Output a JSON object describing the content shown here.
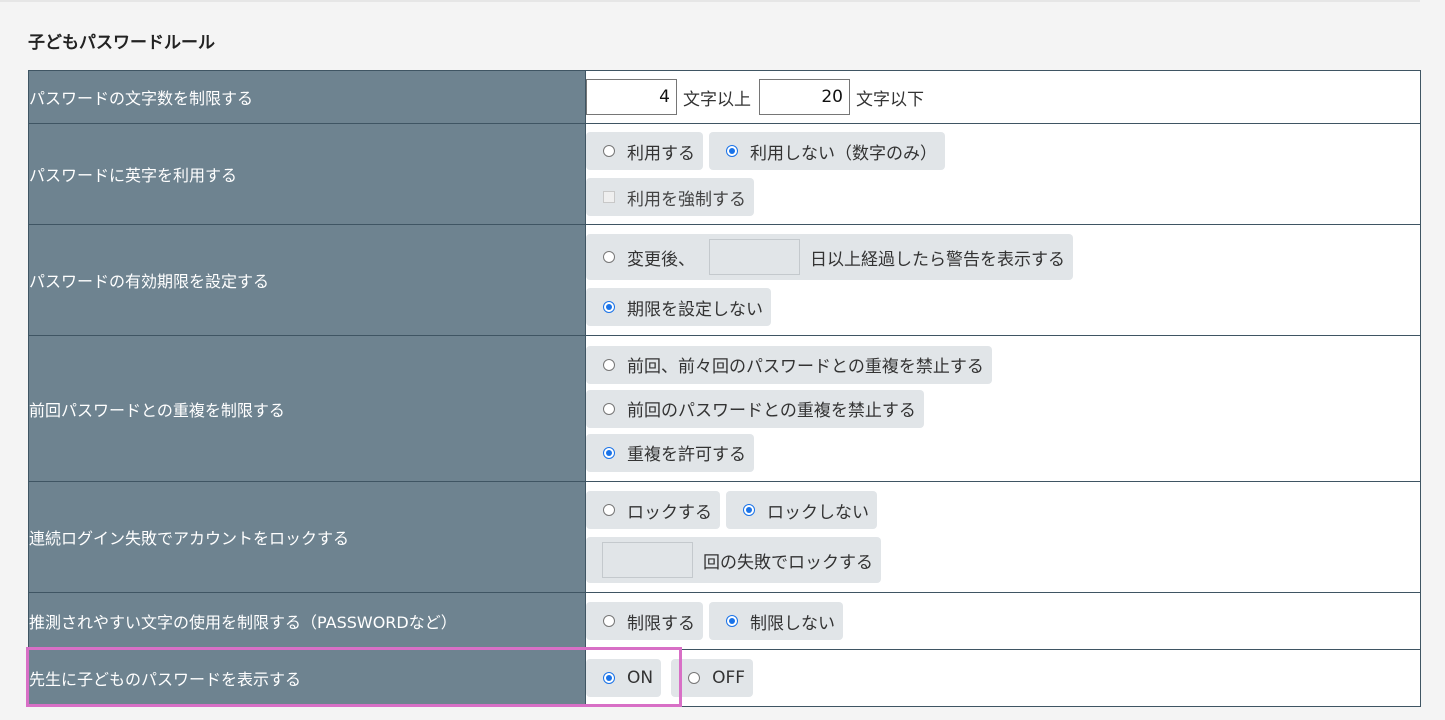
{
  "section_title": "子どもパスワードルール",
  "rules": {
    "length": {
      "label": "パスワードの文字数を制限する",
      "min_value": "4",
      "min_unit": "文字以上",
      "max_value": "20",
      "max_unit": "文字以下"
    },
    "alphabet": {
      "label": "パスワードに英字を利用する",
      "options": [
        "利用する",
        "利用しない（数字のみ）"
      ],
      "selected": "利用しない（数字のみ）",
      "force_checkbox_label": "利用を強制する",
      "force_checkbox_enabled": false
    },
    "expiry": {
      "label": "パスワードの有効期限を設定する",
      "option_after_prefix": "変更後、",
      "option_after_suffix": "日以上経過したら警告を表示する",
      "days_value": "",
      "option_none": "期限を設定しない",
      "selected": "期限を設定しない"
    },
    "history": {
      "label": "前回パスワードとの重複を制限する",
      "options": [
        "前回、前々回のパスワードとの重複を禁止する",
        "前回のパスワードとの重複を禁止する",
        "重複を許可する"
      ],
      "selected": "重複を許可する"
    },
    "lockout": {
      "label": "連続ログイン失敗でアカウントをロックする",
      "options": [
        "ロックする",
        "ロックしない"
      ],
      "selected": "ロックしない",
      "count_value": "",
      "count_suffix": "回の失敗でロックする"
    },
    "guessable": {
      "label": "推測されやすい文字の使用を制限する（PASSWORDなど）",
      "options": [
        "制限する",
        "制限しない"
      ],
      "selected": "制限しない"
    },
    "show_to_teacher": {
      "label": "先生に子どものパスワードを表示する",
      "options": [
        "ON",
        "OFF"
      ],
      "selected": "ON"
    }
  },
  "colors": {
    "label_bg": "#6e8390",
    "option_bg": "#e1e5e8",
    "radio_checked": "#1a73e8",
    "highlight_border": "#d86fc6"
  }
}
